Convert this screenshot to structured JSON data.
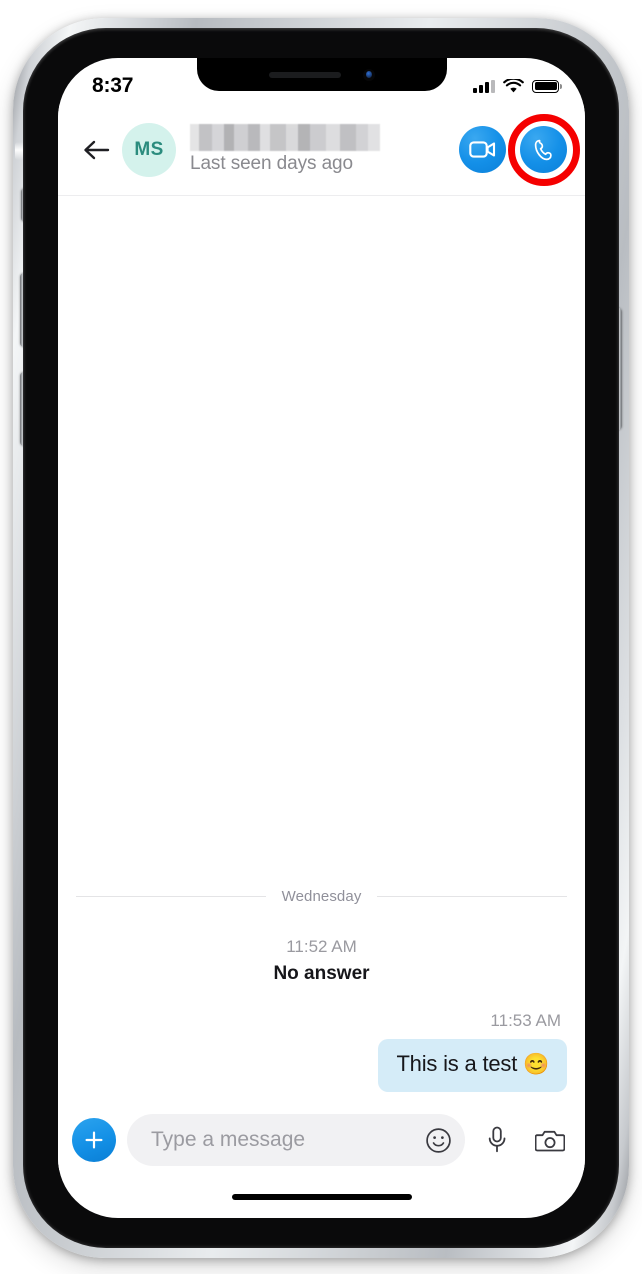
{
  "status_bar": {
    "time": "8:37",
    "signal_icon": "cellular-signal-icon",
    "wifi_icon": "wifi-icon",
    "battery_icon": "battery-full-icon",
    "signal_bars_filled": 3,
    "signal_bars_total": 4,
    "battery_level_percent": 100
  },
  "header": {
    "back_icon": "back-arrow-icon",
    "avatar_initials": "MS",
    "avatar_bg_color": "#d4f2ec",
    "avatar_text_color": "#2b8c7e",
    "contact_name": "",
    "contact_name_redacted": true,
    "contact_status": "Last seen days ago",
    "video_call_icon": "video-camera-icon",
    "audio_call_icon": "phone-handset-icon",
    "action_button_color": "#1490e8",
    "highlight_color": "#f50000",
    "highlight_target": "audio-call-button"
  },
  "conversation": {
    "day_divider_label": "Wednesday",
    "events": [
      {
        "time": "11:52 AM",
        "text": "No answer",
        "kind": "call-event"
      }
    ],
    "messages": [
      {
        "time": "11:53 AM",
        "text": "This is a test ",
        "emoji": "😊",
        "direction": "outgoing",
        "bubble_color": "#d5ecf8"
      }
    ]
  },
  "composer": {
    "add_icon": "plus-icon",
    "add_button_color": "#1390e6",
    "input_value": "",
    "input_placeholder": "Type a message",
    "emoji_icon": "smiley-face-icon",
    "microphone_icon": "microphone-icon",
    "camera_icon": "camera-icon"
  },
  "device": {
    "notch_speaker_icon": "earpiece-speaker-icon",
    "notch_camera_icon": "front-camera-icon",
    "home_indicator_icon": "home-indicator",
    "side_buttons": [
      "silent-switch",
      "volume-up-button",
      "volume-down-button",
      "power-button"
    ]
  }
}
